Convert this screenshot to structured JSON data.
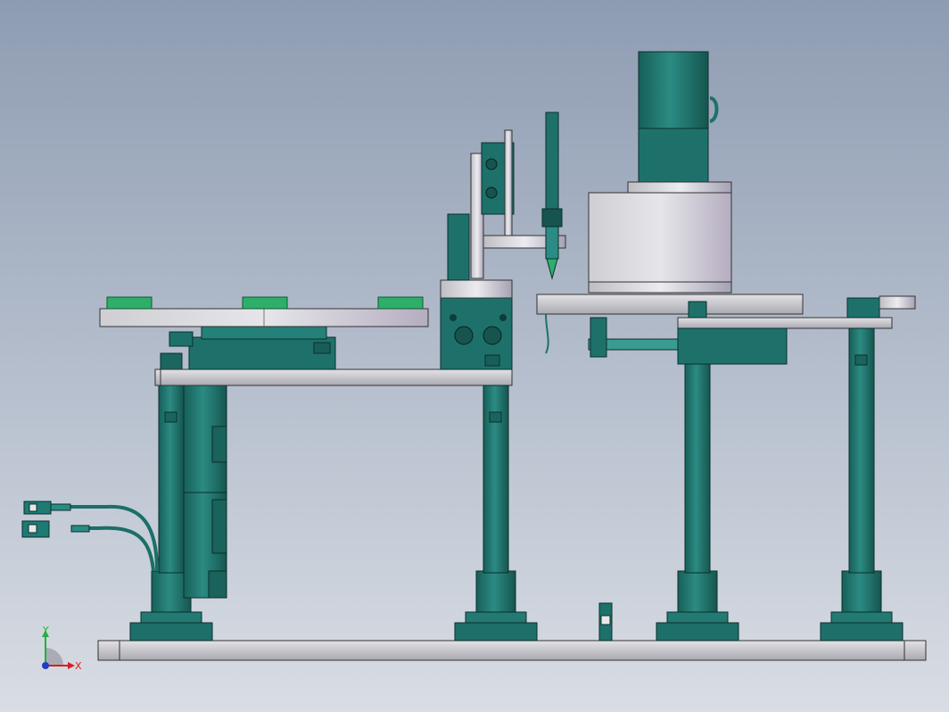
{
  "viewport": {
    "background_top": "#8e9cb2",
    "background_bottom": "#d9dde4"
  },
  "colors": {
    "teal": "#1f7a74",
    "teal_dark": "#0f4f4a",
    "teal_light": "#3a9b92",
    "grey": "#c7c7cc",
    "grey_dark": "#9a9aa0",
    "green_pad": "#2fae6a"
  },
  "triad": {
    "x_label": "X",
    "y_label": "Y",
    "x_color": "#d42020",
    "y_color": "#20b040",
    "z_color": "#2040c0"
  },
  "icons": [
    "coordinate-triad-icon"
  ]
}
